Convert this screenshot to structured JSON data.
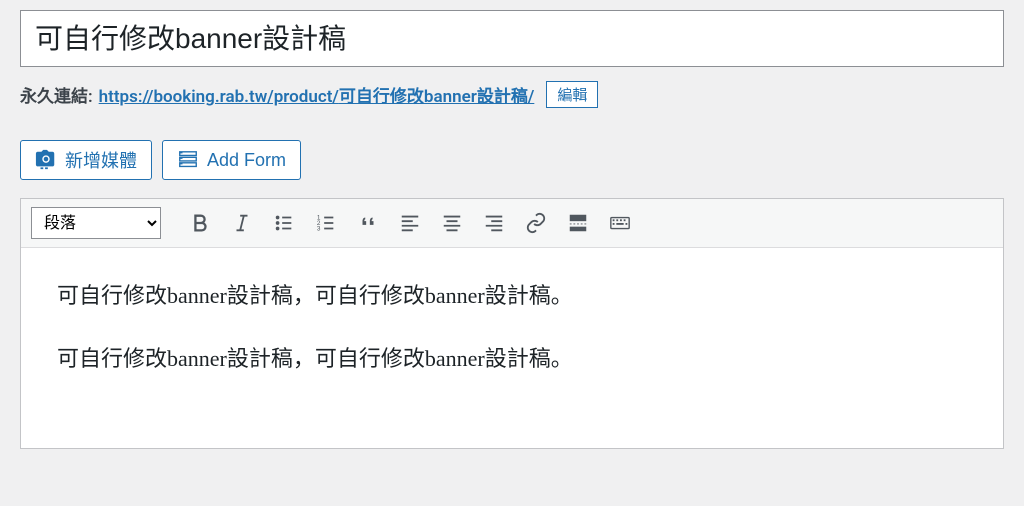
{
  "title": "可自行修改banner設計稿",
  "permalink": {
    "label": "永久連結:",
    "base_url": "https://booking.rab.tw/product/",
    "slug": "可自行修改banner設計稿/",
    "edit_label": "編輯"
  },
  "media_buttons": {
    "add_media": "新增媒體",
    "add_form": "Add Form"
  },
  "toolbar": {
    "format_selected": "段落"
  },
  "content": {
    "p1": "可自行修改banner設計稿，可自行修改banner設計稿。",
    "p2": "可自行修改banner設計稿，可自行修改banner設計稿。"
  }
}
